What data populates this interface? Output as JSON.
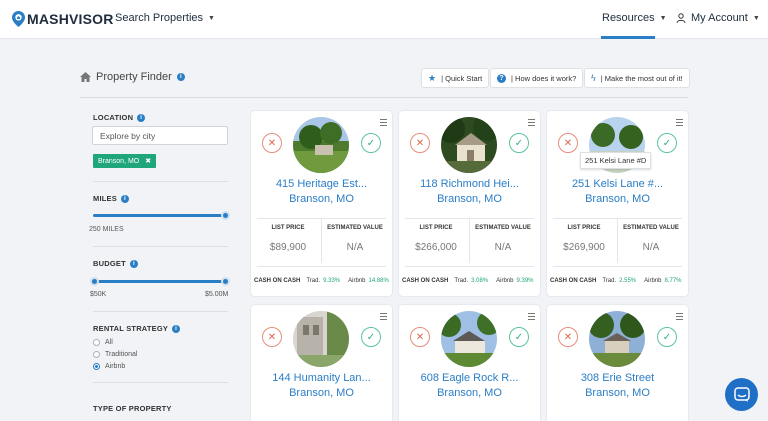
{
  "nav": {
    "logo": "MASHVISOR",
    "search_properties": "Search Properties",
    "resources": "Resources",
    "my_account": "My Account"
  },
  "header": {
    "title": "Property Finder",
    "help_buttons": [
      {
        "icon": "star-icon",
        "label": "| Quick Start"
      },
      {
        "icon": "question-icon",
        "label": "| How does it work?"
      },
      {
        "icon": "bolt-icon",
        "label": "| Make the most out of it!"
      }
    ]
  },
  "filters": {
    "location_label": "LOCATION",
    "city_placeholder": "Explore by city",
    "chip": "Branson, MO",
    "miles_label": "MILES",
    "miles_value": "250 MILES",
    "budget_label": "BUDGET",
    "budget_min": "$50K",
    "budget_max": "$5.00M",
    "rental_label": "RENTAL STRATEGY",
    "rental_options": [
      "All",
      "Traditional",
      "Airbnb"
    ],
    "rental_selected": "Airbnb",
    "type_label": "TYPE OF PROPERTY"
  },
  "card_labels": {
    "list_price": "LIST PRICE",
    "estimated_value": "ESTIMATED VALUE",
    "cash_on_cash": "CASH ON CASH",
    "trad": "Trad.",
    "airbnb": "Airbnb"
  },
  "tooltip": "251 Kelsi Lane #D",
  "properties": [
    {
      "address": "415 Heritage Est...",
      "city": "Branson, MO",
      "list_price": "$89,900",
      "estimated_value": "N/A",
      "trad": "9.33%",
      "airbnb": "14.88%"
    },
    {
      "address": "118 Richmond Hei...",
      "city": "Branson, MO",
      "list_price": "$266,000",
      "estimated_value": "N/A",
      "trad": "3.08%",
      "airbnb": "9.39%"
    },
    {
      "address": "251 Kelsi Lane #...",
      "city": "Branson, MO",
      "list_price": "$269,900",
      "estimated_value": "N/A",
      "trad": "2.55%",
      "airbnb": "8.77%"
    },
    {
      "address": "144 Humanity Lan...",
      "city": "Branson, MO"
    },
    {
      "address": "608 Eagle Rock R...",
      "city": "Branson, MO"
    },
    {
      "address": "308 Erie Street",
      "city": "Branson, MO"
    }
  ]
}
